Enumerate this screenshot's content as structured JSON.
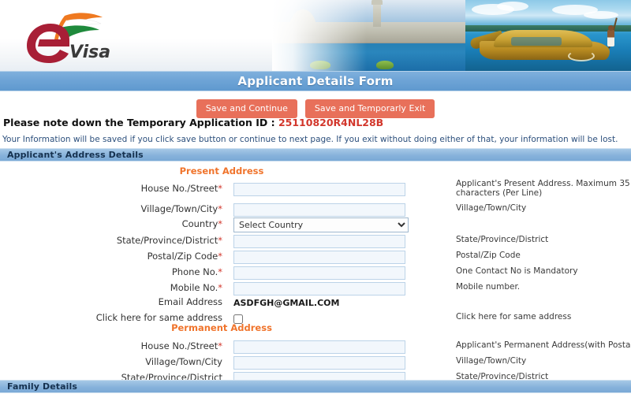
{
  "brand": {
    "logo_letter": "e",
    "logo_word": "Visa",
    "logo_name": "evisa-logo",
    "colors": {
      "logo_red": "#a81f36",
      "saffron": "#ef7920",
      "green": "#1f8a3c",
      "white": "#ffffff"
    }
  },
  "header": {
    "title": "Applicant Details Form",
    "banner_alt": "india-banner-photo",
    "title_bar_color": "#6ea4d6"
  },
  "toolbar": {
    "save_continue_label": "Save and Continue",
    "save_exit_label": "Save and Temporarly Exit",
    "button_color": "#e8705a"
  },
  "notice": {
    "prefix": "Please note down the Temporary Application ID : ",
    "application_id": "25110820R4NL28B",
    "id_color": "#d2362b",
    "warning": "Your Information will be saved if you click save button or continue to next page. If you exit without doing either of that, your information will be lost.",
    "warning_color": "#2c4f7c"
  },
  "sections": {
    "address": {
      "label": "Applicant's Address Details"
    },
    "family": {
      "label": "Family Details"
    }
  },
  "present_address": {
    "heading": "Present Address",
    "heading_color": "#f0742c",
    "fields": [
      {
        "label": "House No./Street",
        "required": true,
        "type": "text",
        "value": "",
        "hint": "Applicant's Present Address. Maximum 35 characters (Per Line)"
      },
      {
        "label": "Village/Town/City",
        "required": true,
        "type": "text",
        "value": "",
        "hint": "Village/Town/City"
      },
      {
        "label": "Country",
        "required": true,
        "type": "select",
        "value": "Select Country",
        "options": [
          "Select Country"
        ],
        "hint": ""
      },
      {
        "label": "State/Province/District",
        "required": true,
        "type": "text",
        "value": "",
        "hint": "State/Province/District"
      },
      {
        "label": "Postal/Zip Code",
        "required": true,
        "type": "text",
        "value": "",
        "hint": "Postal/Zip Code"
      },
      {
        "label": "Phone No.",
        "required": true,
        "type": "text",
        "value": "",
        "hint": "One Contact No is Mandatory"
      },
      {
        "label": "Mobile No.",
        "required": true,
        "type": "text",
        "value": "",
        "hint": "Mobile number."
      },
      {
        "label": "Email Address",
        "required": false,
        "type": "static",
        "value": "ASDFGH@GMAIL.COM",
        "hint": ""
      },
      {
        "label": "Click here for same address",
        "required": false,
        "type": "checkbox",
        "value": "",
        "checked": false,
        "hint": "Click here for same address"
      }
    ]
  },
  "permanent_address": {
    "heading": "Permanent Address",
    "heading_color": "#f0742c",
    "fields": [
      {
        "label": "House No./Street",
        "required": true,
        "type": "text",
        "value": "",
        "hint": "Applicant's Permanent Address(with Postal/Zip Code)"
      },
      {
        "label": "Village/Town/City",
        "required": false,
        "type": "text",
        "value": "",
        "hint": "Village/Town/City"
      },
      {
        "label": "State/Province/District",
        "required": false,
        "type": "text",
        "value": "",
        "hint": "State/Province/District"
      }
    ]
  }
}
